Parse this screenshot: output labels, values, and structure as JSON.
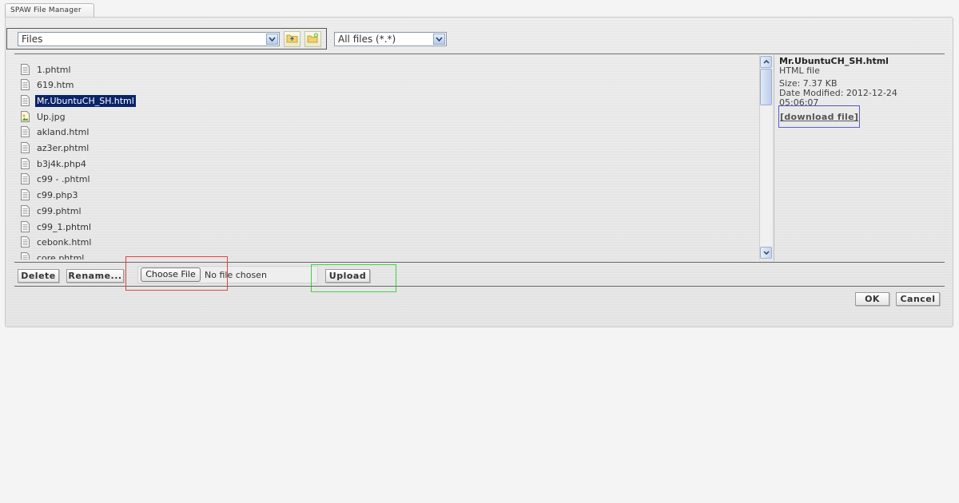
{
  "window": {
    "tab_title": "SPAW File Manager"
  },
  "toolbar": {
    "directory_select_value": "Files",
    "filter_select_value": "All files (*.*)",
    "up_button_icon": "folder-up-icon",
    "new_folder_button_icon": "new-folder-icon"
  },
  "files": [
    {
      "name": "1.phtml",
      "icon": "document-icon"
    },
    {
      "name": "619.htm",
      "icon": "document-icon"
    },
    {
      "name": "Mr.UbuntuCH_SH.html",
      "icon": "document-icon",
      "selected": true
    },
    {
      "name": "Up.jpg",
      "icon": "image-icon"
    },
    {
      "name": "akland.html",
      "icon": "document-icon"
    },
    {
      "name": "az3er.phtml",
      "icon": "document-icon"
    },
    {
      "name": "b3j4k.php4",
      "icon": "document-icon"
    },
    {
      "name": "c99 - .phtml",
      "icon": "document-icon"
    },
    {
      "name": "c99.php3",
      "icon": "document-icon"
    },
    {
      "name": "c99.phtml",
      "icon": "document-icon"
    },
    {
      "name": "c99_1.phtml",
      "icon": "document-icon"
    },
    {
      "name": "cebonk.html",
      "icon": "document-icon"
    },
    {
      "name": "core.phtml",
      "icon": "document-icon"
    }
  ],
  "details": {
    "file_name": "Mr.UbuntuCH_SH.html",
    "file_type": "HTML file",
    "size": "Size: 7.37 KB",
    "date_modified": "Date Modified: 2012-12-24 05:06:07",
    "download_label": "[download file]"
  },
  "actions": {
    "delete_label": "Delete",
    "rename_label": "Rename...",
    "choose_file_label": "Choose File",
    "no_file_text": "No file chosen",
    "upload_label": "Upload",
    "ok_label": "OK",
    "cancel_label": "Cancel"
  },
  "colors": {
    "selection": "#0a246a",
    "highlight_red": "#e04040",
    "highlight_green": "#3ecf3e",
    "highlight_blue": "#5b5bc7"
  }
}
